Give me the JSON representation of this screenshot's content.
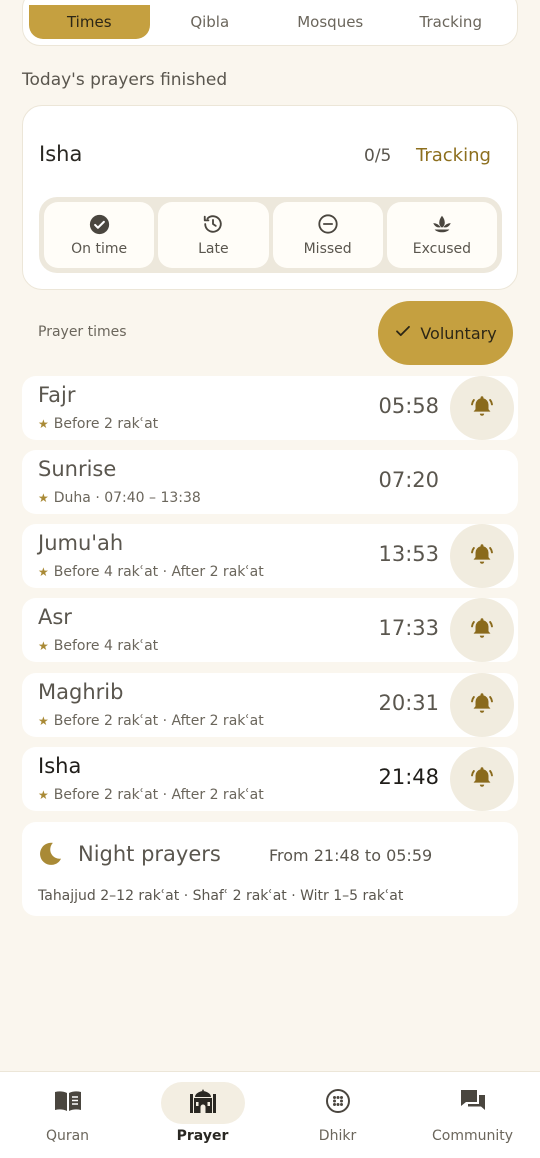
{
  "tabs": [
    "Times",
    "Qibla",
    "Mosques",
    "Tracking"
  ],
  "section_title": "Today's prayers finished",
  "status": {
    "prayer": "Isha",
    "count": "0/5",
    "link": "Tracking",
    "options": [
      {
        "label": "On time",
        "icon": "check-circle-icon"
      },
      {
        "label": "Late",
        "icon": "history-icon"
      },
      {
        "label": "Missed",
        "icon": "minus-circle-icon"
      },
      {
        "label": "Excused",
        "icon": "lotus-icon"
      }
    ]
  },
  "prayer_times_label": "Prayer times",
  "voluntary_label": "Voluntary",
  "prayers": [
    {
      "name": "Fajr",
      "time": "05:58",
      "note": "Before 2 rakʿat",
      "bell": true
    },
    {
      "name": "Sunrise",
      "time": "07:20",
      "note": "Duha · 07:40 – 13:38",
      "bell": false
    },
    {
      "name": "Jumu'ah",
      "time": "13:53",
      "note": "Before 4 rakʿat · After 2 rakʿat",
      "bell": true
    },
    {
      "name": "Asr",
      "time": "17:33",
      "note": "Before 4 rakʿat",
      "bell": true
    },
    {
      "name": "Maghrib",
      "time": "20:31",
      "note": "Before 2 rakʿat · After 2 rakʿat",
      "bell": true
    },
    {
      "name": "Isha",
      "time": "21:48",
      "note": "Before 2 rakʿat · After 2 rakʿat",
      "bell": true
    }
  ],
  "night": {
    "title": "Night prayers",
    "range": "From 21:48 to 05:59",
    "detail": "Tahajjud 2–12 rakʿat · Shafʿ 2 rakʿat · Witr 1–5 rakʿat"
  },
  "nav": [
    {
      "label": "Quran",
      "icon": "book-icon"
    },
    {
      "label": "Prayer",
      "icon": "mosque-icon"
    },
    {
      "label": "Dhikr",
      "icon": "beads-icon"
    },
    {
      "label": "Community",
      "icon": "chat-icon"
    }
  ],
  "colors": {
    "accent": "#c5a040",
    "accent_text": "#8d6f1e",
    "background": "#faf6ee",
    "card": "#ffffff",
    "icon": "#8a6a1c"
  }
}
